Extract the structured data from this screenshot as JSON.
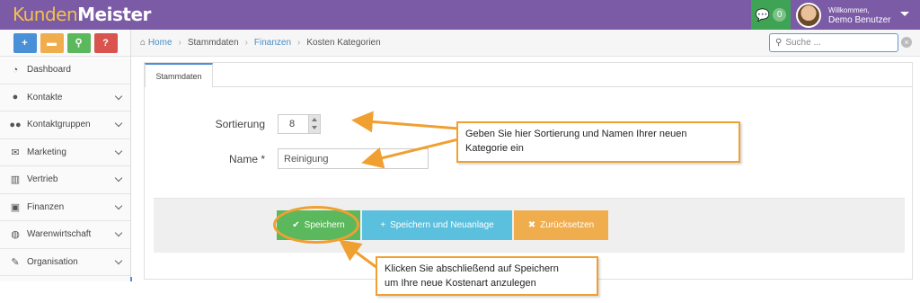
{
  "header": {
    "logo_part1": "Kunden",
    "logo_part2": "Meister",
    "message_count": "0",
    "welcome_line1": "Willkommen,",
    "welcome_line2": "Demo Benutzer"
  },
  "quick_buttons": [
    {
      "icon": "plus-icon",
      "glyph": "+",
      "color": "#4a90d9"
    },
    {
      "icon": "comment-icon",
      "glyph": "●",
      "color": "#f0ad4e"
    },
    {
      "icon": "search-icon",
      "glyph": "⌕",
      "color": "#5cb85c"
    },
    {
      "icon": "help-icon",
      "glyph": "?",
      "color": "#d9534f"
    }
  ],
  "sidebar": {
    "items": [
      {
        "label": "Dashboard",
        "icon": "dashboard-icon"
      },
      {
        "label": "Kontakte",
        "icon": "user-icon"
      },
      {
        "label": "Kontaktgruppen",
        "icon": "users-icon"
      },
      {
        "label": "Marketing",
        "icon": "envelope-icon"
      },
      {
        "label": "Vertrieb",
        "icon": "bar-chart-icon"
      },
      {
        "label": "Finanzen",
        "icon": "money-icon"
      },
      {
        "label": "Warenwirtschaft",
        "icon": "globe-icon"
      },
      {
        "label": "Organisation",
        "icon": "edit-icon"
      }
    ]
  },
  "breadcrumb": {
    "home": "Home",
    "item1": "Stammdaten",
    "item2": "Finanzen",
    "item3": "Kosten Kategorien"
  },
  "search": {
    "placeholder": "Suche ..."
  },
  "tabs": {
    "stammdaten": "Stammdaten"
  },
  "form": {
    "sortierung_label": "Sortierung",
    "sortierung_value": "8",
    "name_label": "Name *",
    "name_value": "Reinigung"
  },
  "actions": {
    "save": "Speichern",
    "save_new": "Speichern und Neuanlage",
    "reset": "Zurücksetzen"
  },
  "callouts": {
    "top_line1": "Geben Sie hier Sortierung und Namen Ihrer neuen",
    "top_line2": "Kategorie ein",
    "bottom_line1": "Klicken Sie abschließend auf Speichern",
    "bottom_line2": "um Ihre neue Kostenart anzulegen"
  },
  "colors": {
    "brand": "#7b5aa6",
    "accent_orange": "#f0a030",
    "save_green": "#5cb85c",
    "info_blue": "#5bc0de",
    "warn_orange": "#f0ad4e"
  }
}
